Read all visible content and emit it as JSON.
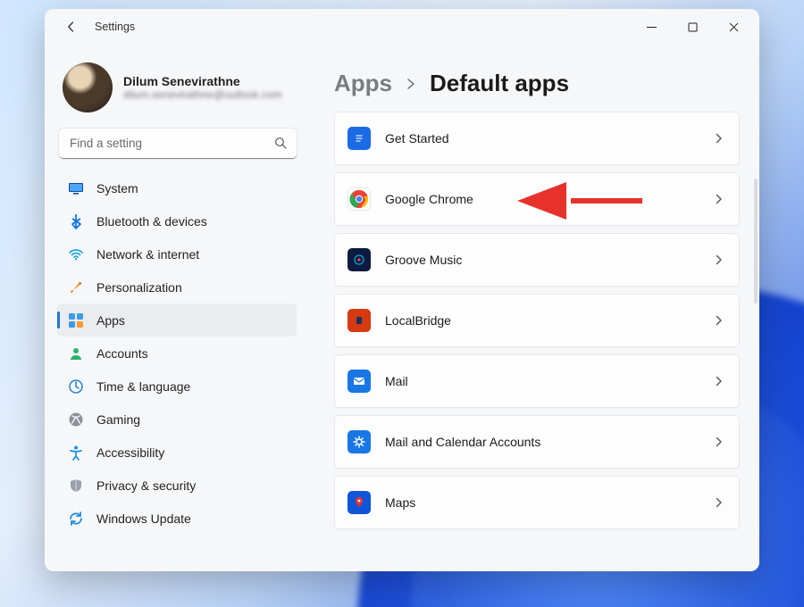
{
  "titlebar": {
    "title": "Settings"
  },
  "profile": {
    "name": "Dilum Senevirathne",
    "email": "dilum.senevirathne@outlook.com"
  },
  "search": {
    "placeholder": "Find a setting"
  },
  "nav": {
    "items": [
      {
        "label": "System",
        "icon": "system"
      },
      {
        "label": "Bluetooth & devices",
        "icon": "bluetooth"
      },
      {
        "label": "Network & internet",
        "icon": "network"
      },
      {
        "label": "Personalization",
        "icon": "personalization"
      },
      {
        "label": "Apps",
        "icon": "apps",
        "selected": true
      },
      {
        "label": "Accounts",
        "icon": "accounts"
      },
      {
        "label": "Time & language",
        "icon": "time"
      },
      {
        "label": "Gaming",
        "icon": "gaming"
      },
      {
        "label": "Accessibility",
        "icon": "accessibility"
      },
      {
        "label": "Privacy & security",
        "icon": "privacy"
      },
      {
        "label": "Windows Update",
        "icon": "update"
      }
    ]
  },
  "breadcrumb": {
    "parent": "Apps",
    "leaf": "Default apps"
  },
  "apps": [
    {
      "label": "Get Started",
      "icon": "getstarted"
    },
    {
      "label": "Google Chrome",
      "icon": "chrome",
      "highlight": true
    },
    {
      "label": "Groove Music",
      "icon": "groove"
    },
    {
      "label": "LocalBridge",
      "icon": "localbridge"
    },
    {
      "label": "Mail",
      "icon": "mail"
    },
    {
      "label": "Mail and Calendar Accounts",
      "icon": "mailcal"
    },
    {
      "label": "Maps",
      "icon": "maps"
    }
  ],
  "colors": {
    "accent": "#1976d2",
    "arrow": "#e7322c"
  }
}
